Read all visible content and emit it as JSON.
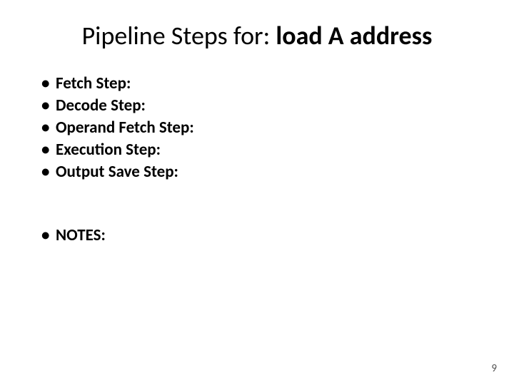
{
  "title": {
    "prefix": "Pipeline Steps for: ",
    "bold": "load A address"
  },
  "bullets": [
    "Fetch Step:",
    "Decode Step:",
    "Operand Fetch Step:",
    "Execution Step:",
    "Output Save Step:"
  ],
  "notes_label": "NOTES:",
  "page_number": "9",
  "bullet_char": "•"
}
